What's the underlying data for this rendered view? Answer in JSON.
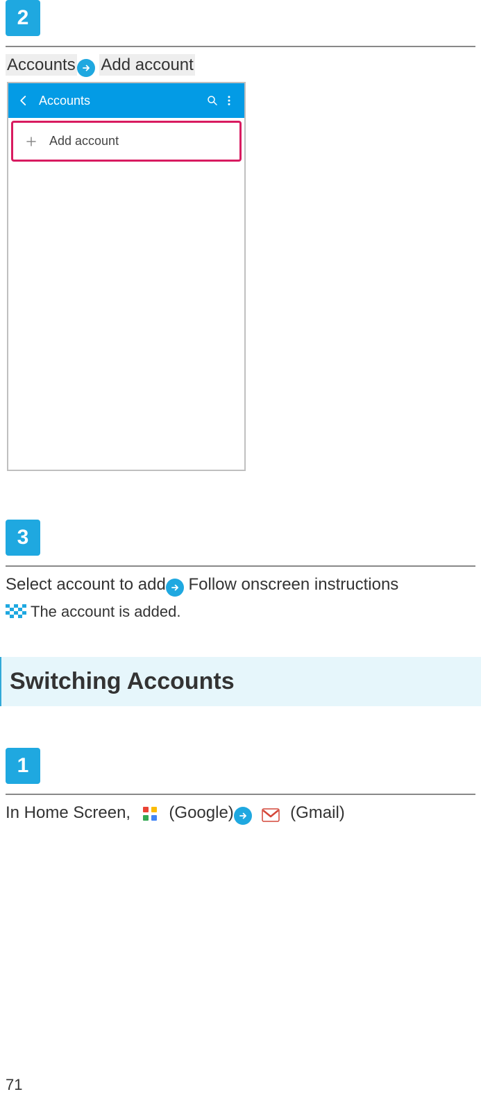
{
  "steps": {
    "s2": {
      "num": "2"
    },
    "s3": {
      "num": "3"
    },
    "s1b": {
      "num": "1"
    }
  },
  "breadcrumb": {
    "item1": "Accounts",
    "item2": "Add account"
  },
  "phone": {
    "title": "Accounts",
    "addRow": "Add account"
  },
  "step3": {
    "part1": "Select account to add",
    "part2": "Follow onscreen instructions"
  },
  "result": {
    "text": "The account is added."
  },
  "section": {
    "title": "Switching Accounts"
  },
  "homeLine": {
    "prefix": "In Home Screen, ",
    "google": " (Google)",
    "gmail": " (Gmail)"
  },
  "pageNumber": "71"
}
